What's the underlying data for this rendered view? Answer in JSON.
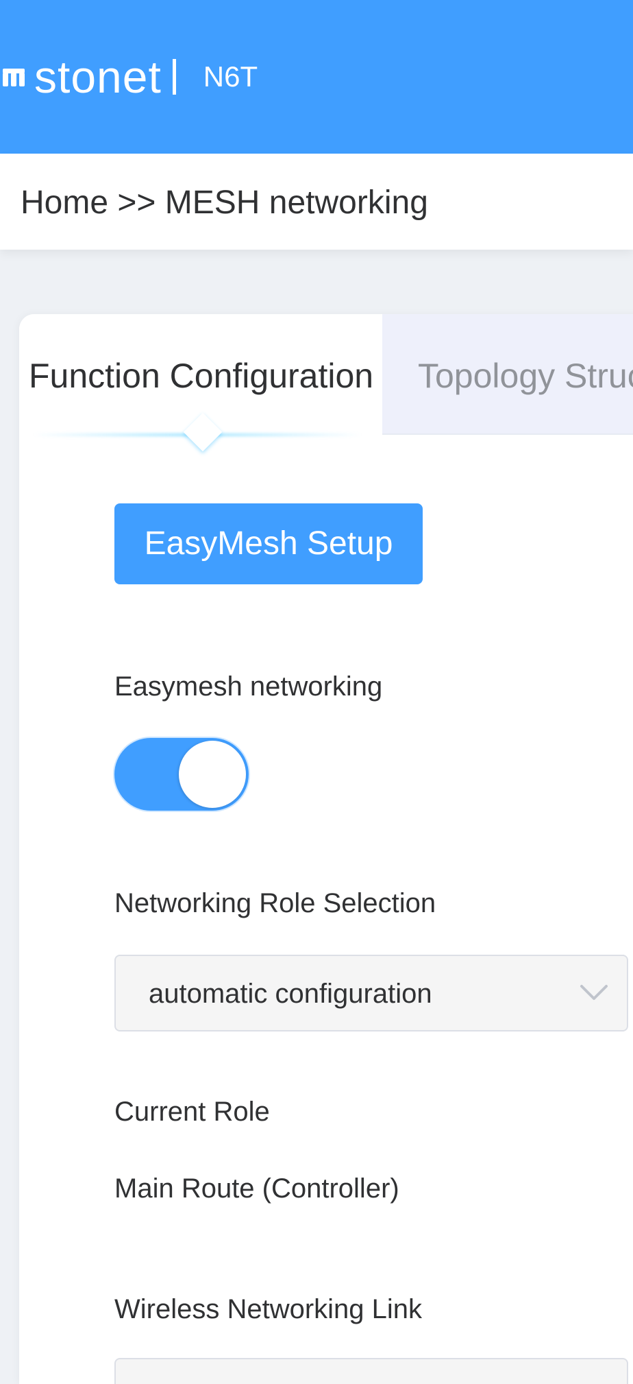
{
  "header": {
    "brand": "stonet",
    "model": "N6T"
  },
  "breadcrumb": {
    "text": "Home >> MESH networking"
  },
  "tabs": [
    {
      "label": "Function Configuration",
      "active": true
    },
    {
      "label": "Topology Struc",
      "active": false
    }
  ],
  "setup_button": {
    "label": "EasyMesh Setup"
  },
  "easymesh": {
    "label": "Easymesh networking",
    "enabled": true
  },
  "role_selection": {
    "label": "Networking Role Selection",
    "value": "automatic configuration"
  },
  "current_role": {
    "label": "Current Role",
    "value": "Main Route (Controller)"
  },
  "wireless_link": {
    "label": "Wireless Networking Link"
  },
  "colors": {
    "primary": "#409eff",
    "text": "#303133",
    "muted": "#909399",
    "background": "#eef1f5"
  },
  "icons": {
    "logo": "stonet-logo-icon",
    "dropdown": "chevron-down-icon"
  }
}
